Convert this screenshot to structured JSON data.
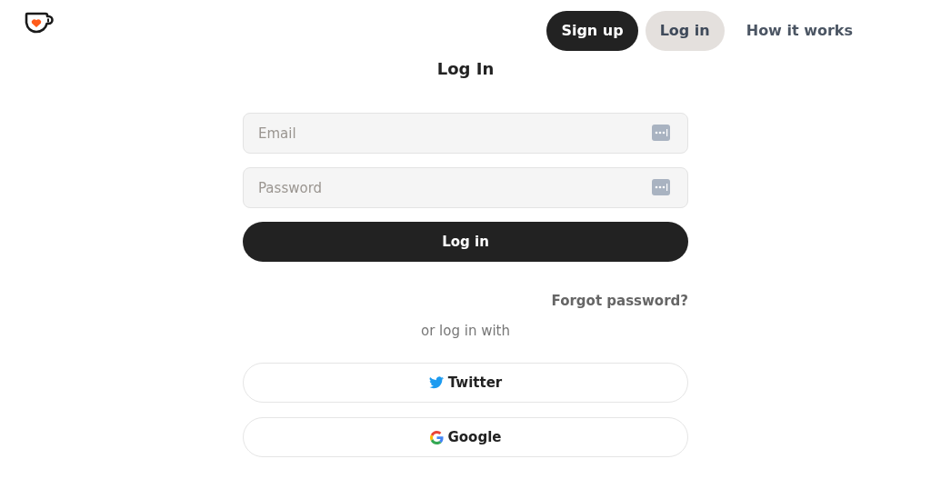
{
  "nav": [
    {
      "label": "Sign up",
      "kind": "primary",
      "selected": false
    },
    {
      "label": "Log in",
      "kind": "pill",
      "selected": true
    },
    {
      "label": "How it works",
      "kind": "link",
      "selected": false
    }
  ],
  "form": {
    "title": "Log In",
    "fields": [
      {
        "placeholder": "Email"
      },
      {
        "placeholder": "Password"
      }
    ],
    "submit": "Log in",
    "forgot": "Forgot password?",
    "divider": "or log in with",
    "social": [
      {
        "label": "Twitter",
        "kind": "twitter"
      },
      {
        "label": "Google",
        "kind": "google"
      }
    ]
  }
}
